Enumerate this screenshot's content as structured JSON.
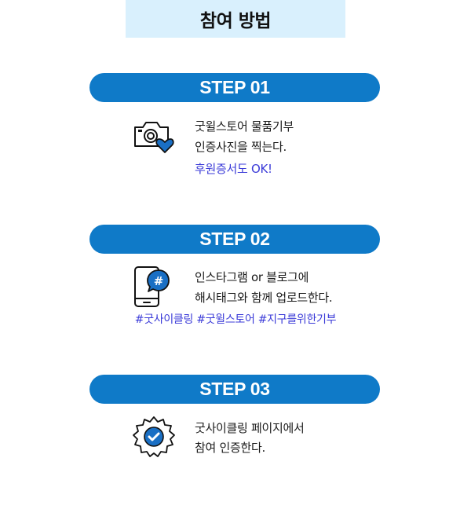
{
  "title": "참여 방법",
  "colors": {
    "title_bg": "#d9f0fd",
    "pill_bg": "#0f7ac8",
    "accent_text": "#3a3ad8",
    "icon_blue": "#1a6fc4"
  },
  "steps": [
    {
      "label": "STEP 01",
      "icon": "camera-heart-icon",
      "lines": [
        "굿윌스토어 물품기부",
        "인증사진을 찍는다."
      ],
      "note": "후원증서도 OK!"
    },
    {
      "label": "STEP 02",
      "icon": "phone-hashtag-icon",
      "lines": [
        "인스타그램 or 블로그에",
        "해시태그와 함께 업로드한다."
      ],
      "hashtags": "#굿사이클링 #굿윌스토어 #지구를위한기부"
    },
    {
      "label": "STEP 03",
      "icon": "verified-badge-icon",
      "lines": [
        "굿사이클링 페이지에서",
        "참여 인증한다."
      ]
    }
  ]
}
